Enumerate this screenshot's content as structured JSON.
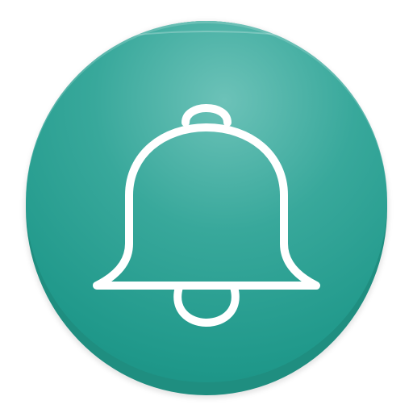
{
  "app_icon": {
    "icon": "bell-icon",
    "colors": {
      "background_highlight": "#6cc2b8",
      "background_mid": "#38a89b",
      "background_low": "#1f988a",
      "edge": "#1f8e80",
      "glyph": "#ffffff"
    }
  }
}
